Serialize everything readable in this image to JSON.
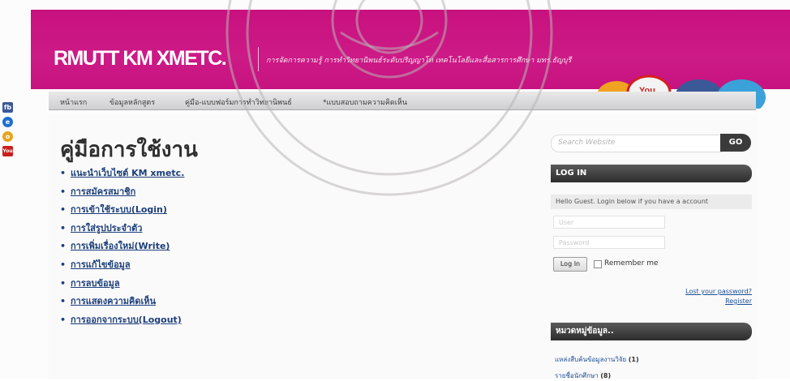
{
  "header": {
    "logo": "RMUTT KM XMETC.",
    "tagline": "การจัดการความรู้ การทำวิทยานิพนธ์ระดับปริญญาโท เทคโนโลยีและสื่อสารการศึกษา มทร.ธัญบุรี"
  },
  "nav": {
    "items": [
      {
        "label": "หน้าแรก"
      },
      {
        "label": "ข้อมูลหลักสูตร"
      },
      {
        "label": "คู่มือ-แบบฟอร์มการทำวิทยานิพนธ์"
      },
      {
        "label": "*แบบสอบถามความคิดเห็น"
      }
    ]
  },
  "side_icons": [
    {
      "icon": "facebook-icon",
      "glyph": "fb",
      "color": "#3b5998"
    },
    {
      "icon": "globe-icon",
      "glyph": "e",
      "color": "#1c6fd0"
    },
    {
      "icon": "chrome-icon",
      "glyph": "o",
      "color": "#e7a51a"
    },
    {
      "icon": "youtube-icon",
      "glyph": "You",
      "color": "#c8201e"
    }
  ],
  "main": {
    "title": "คู่มือการใช้งาน",
    "links": [
      "แนะนำเว็บไซต์ KM xmetc.",
      "การสมัครสมาชิก",
      "การเข้าใช้ระบบ(Login)",
      "การใส่รูปประจำตัว",
      "การเพิ่มเรื่องใหม่(Write)",
      "การแก้ไขข้อมูล",
      "การลบข้อมูล",
      "การแสดงความคิดเห็น",
      "การออกจากระบบ(Logout)"
    ]
  },
  "sidebar": {
    "search_placeholder": "Search Website",
    "search_button": "GO",
    "login_title": "LOG IN",
    "hello_text": "Hello Guest. Login below if you have a account",
    "user_placeholder": "User",
    "password_placeholder": "Password",
    "login_button": "Log In",
    "remember_label": "Remember me",
    "lost_password": "Lost your password?",
    "register": "Register",
    "categories_title": "หมวดหมู่ข้อมูล..",
    "categories": [
      {
        "label": "แหล่งสืบค้นข้อมูลงานวิจัย",
        "count": "(1)"
      },
      {
        "label": "รายชื่อนักศึกษา",
        "count": "(8)"
      }
    ]
  },
  "colors": {
    "banner": "#c8117f",
    "link": "#1b3f7a",
    "dark_head": "#2d2d2d"
  }
}
